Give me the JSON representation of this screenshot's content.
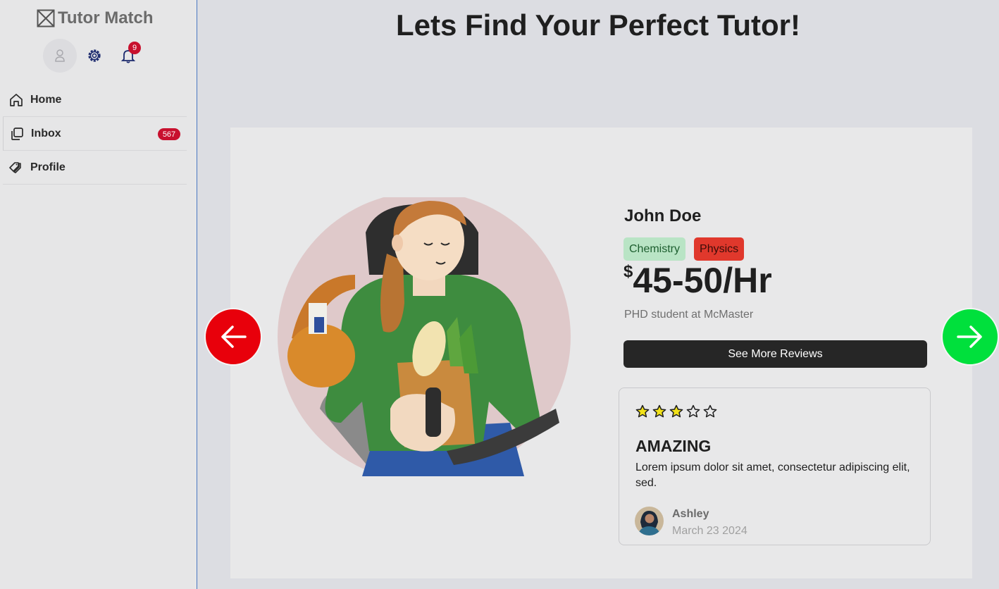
{
  "sidebar": {
    "brand": "Tutor Match",
    "notifications_count": "9",
    "nav": [
      {
        "label": "Home",
        "icon": "home-icon"
      },
      {
        "label": "Inbox",
        "icon": "inbox-icon",
        "badge": "567"
      },
      {
        "label": "Profile",
        "icon": "tag-icon"
      }
    ]
  },
  "main": {
    "title": "Lets Find Your Perfect Tutor!",
    "tutor": {
      "name": "John Doe",
      "subjects": [
        "Chemistry",
        "Physics"
      ],
      "currency": "$",
      "rate": "45-50/Hr",
      "description": "PHD student at McMaster"
    },
    "reviews_button": "See More Reviews",
    "review": {
      "rating": 3,
      "max_rating": 5,
      "title": "AMAZING",
      "body": "Lorem ipsum dolor sit amet, consectetur adipiscing elit, sed.",
      "author": "Ashley",
      "date": "March 23 2024"
    }
  },
  "colors": {
    "prev_button": "#e8000b",
    "next_button": "#00e03c",
    "badge": "#c8102e",
    "star_fill": "#f2e21a"
  }
}
